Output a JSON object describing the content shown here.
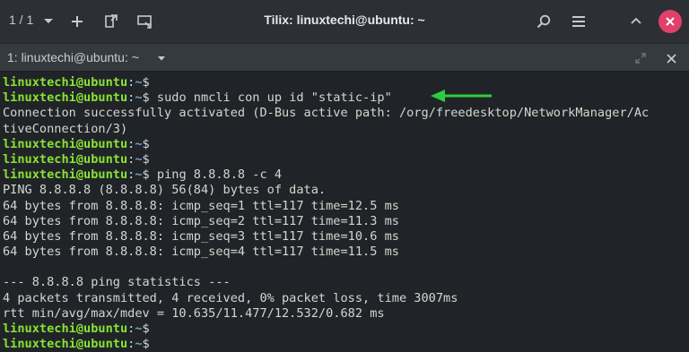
{
  "window": {
    "session_count": "1 / 1",
    "title": "Tilix: linuxtechi@ubuntu: ~"
  },
  "tab": {
    "label": "1: linuxtechi@ubuntu: ~"
  },
  "icons": {
    "dropdown": "chevron-down-icon",
    "add": "plus-icon",
    "detach": "detach-icon",
    "sync": "sync-input-icon",
    "search": "search-icon",
    "menu": "hamburger-menu-icon",
    "minimize": "minimize-icon",
    "close": "close-icon",
    "tab_maximize": "maximize-icon",
    "tab_close": "close-icon",
    "annotation": "arrow-left-icon"
  },
  "colors": {
    "prompt_user": "#8ae234",
    "prompt_path": "#729fcf",
    "text": "#d3d7cf",
    "close_button": "#e0406a",
    "arrow": "#2ecc40"
  },
  "terminal": {
    "prompt_user": "linuxtechi@ubuntu",
    "prompt_colon": ":",
    "prompt_path": "~",
    "prompt_dollar": "$",
    "lines": [
      {
        "prompt": true,
        "cmd": ""
      },
      {
        "prompt": true,
        "cmd": " sudo nmcli con up id \"static-ip\""
      },
      {
        "prompt": false,
        "text": "Connection successfully activated (D-Bus active path: /org/freedesktop/NetworkManager/Ac"
      },
      {
        "prompt": false,
        "text": "tiveConnection/3)"
      },
      {
        "prompt": true,
        "cmd": ""
      },
      {
        "prompt": true,
        "cmd": ""
      },
      {
        "prompt": true,
        "cmd": " ping 8.8.8.8 -c 4"
      },
      {
        "prompt": false,
        "text": "PING 8.8.8.8 (8.8.8.8) 56(84) bytes of data."
      },
      {
        "prompt": false,
        "text": "64 bytes from 8.8.8.8: icmp_seq=1 ttl=117 time=12.5 ms"
      },
      {
        "prompt": false,
        "text": "64 bytes from 8.8.8.8: icmp_seq=2 ttl=117 time=11.3 ms"
      },
      {
        "prompt": false,
        "text": "64 bytes from 8.8.8.8: icmp_seq=3 ttl=117 time=10.6 ms"
      },
      {
        "prompt": false,
        "text": "64 bytes from 8.8.8.8: icmp_seq=4 ttl=117 time=11.5 ms"
      },
      {
        "prompt": false,
        "text": ""
      },
      {
        "prompt": false,
        "text": "--- 8.8.8.8 ping statistics ---"
      },
      {
        "prompt": false,
        "text": "4 packets transmitted, 4 received, 0% packet loss, time 3007ms"
      },
      {
        "prompt": false,
        "text": "rtt min/avg/max/mdev = 10.635/11.477/12.532/0.682 ms"
      },
      {
        "prompt": true,
        "cmd": ""
      },
      {
        "prompt": true,
        "cmd": ""
      }
    ]
  }
}
